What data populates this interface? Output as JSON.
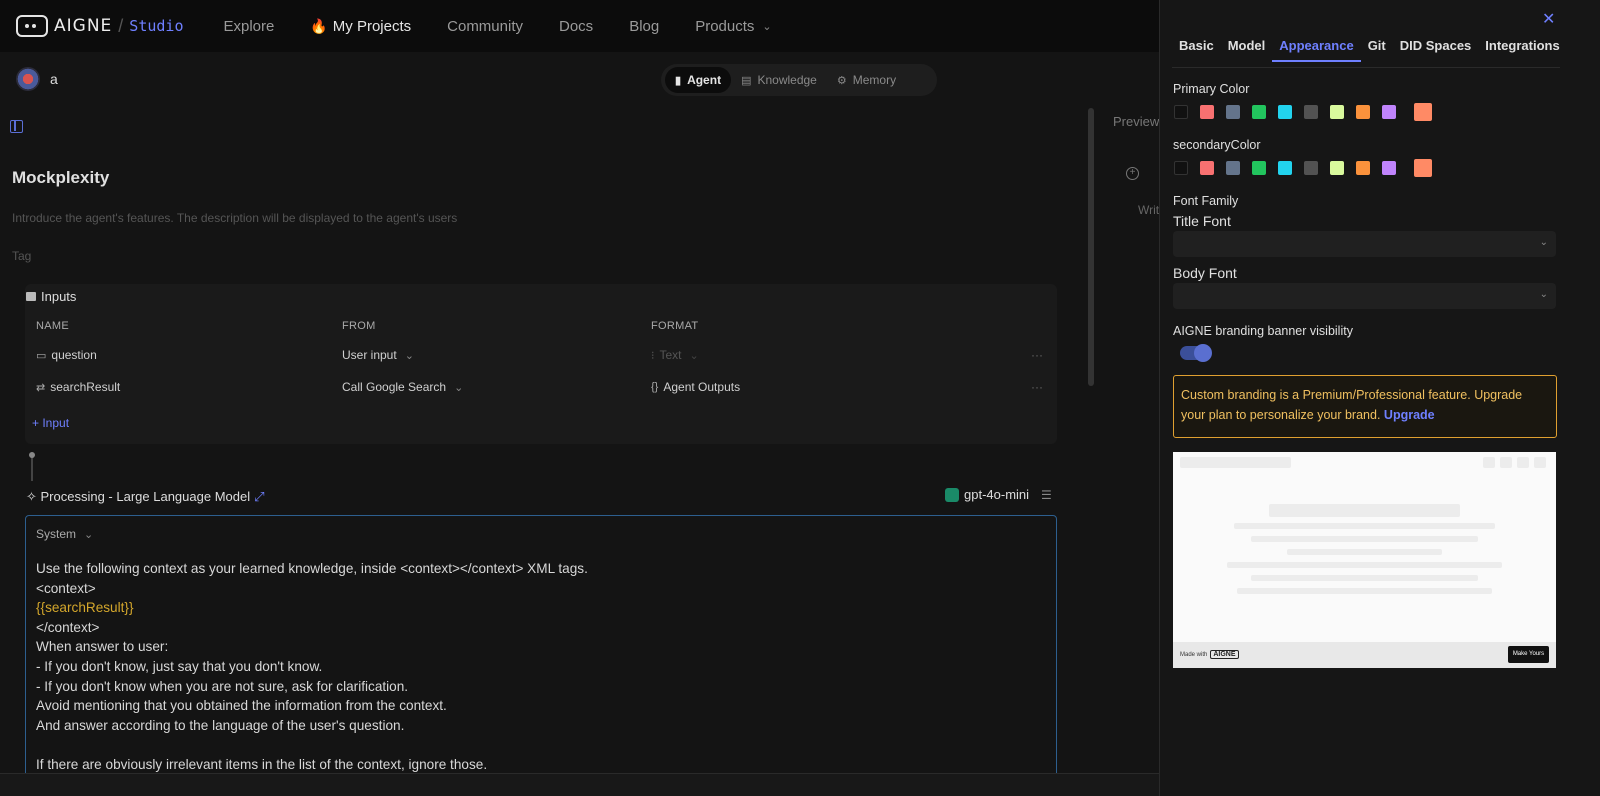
{
  "nav": {
    "logo": "AIGNE",
    "studio": "Studio",
    "items": [
      "Explore",
      "My Projects",
      "Community",
      "Docs",
      "Blog",
      "Products"
    ]
  },
  "project": {
    "name": "a"
  },
  "segments": [
    "Agent",
    "Knowledge",
    "Memory"
  ],
  "agent": {
    "title": "Mockplexity",
    "description_placeholder": "Introduce the agent's features. The description will be displayed to the agent's users",
    "tag_placeholder": "Tag"
  },
  "inputs": {
    "title": "Inputs",
    "headers": [
      "NAME",
      "FROM",
      "FORMAT"
    ],
    "rows": [
      {
        "name": "question",
        "from": "User input",
        "format": "Text"
      },
      {
        "name": "searchResult",
        "from": "Call Google Search",
        "format": "Agent Outputs"
      }
    ],
    "add_label": "Input"
  },
  "processing": {
    "label": "Processing -  Large Language Model",
    "model": "gpt-4o-mini",
    "role": "System",
    "lines": [
      "Use the following context as your learned knowledge, inside <context></context> XML tags.",
      "<context>",
      "{{searchResult}}",
      "</context>",
      "When answer to user:",
      "- If you don't know, just say that you don't know.",
      "- If you don't know when you are not sure, ask for clarification.",
      "Avoid mentioning that you obtained the information from the context.",
      "And answer according to the language of the user's question.",
      "",
      "If there are obviously irrelevant items in the list of the context, ignore those."
    ]
  },
  "preview_panel": {
    "label": "Preview",
    "write_partial": "Writ"
  },
  "drawer": {
    "tabs": [
      "Basic",
      "Model",
      "Appearance",
      "Git",
      "DID Spaces",
      "Integrations"
    ],
    "active_tab": "Appearance",
    "primary_color_label": "Primary Color",
    "secondary_color_label": "secondaryColor",
    "swatch_colors": [
      "#111111",
      "#f87171",
      "#64748b",
      "#22c55e",
      "#22d3ee",
      "#525252",
      "#d9f99d",
      "#fb923c",
      "#c084fc"
    ],
    "selected_color": "#ff8a65",
    "font_family_label": "Font Family",
    "title_font_label": "Title Font",
    "body_font_label": "Body Font",
    "branding_label": "AIGNE branding banner visibility",
    "branding_enabled": true,
    "warning_text": "Custom branding is a Premium/Professional feature. Upgrade your plan to personalize your brand.",
    "warning_link": "Upgrade",
    "preview_made_with": "Made with",
    "preview_logo": "AIGNE",
    "preview_button": "Make Yours"
  }
}
